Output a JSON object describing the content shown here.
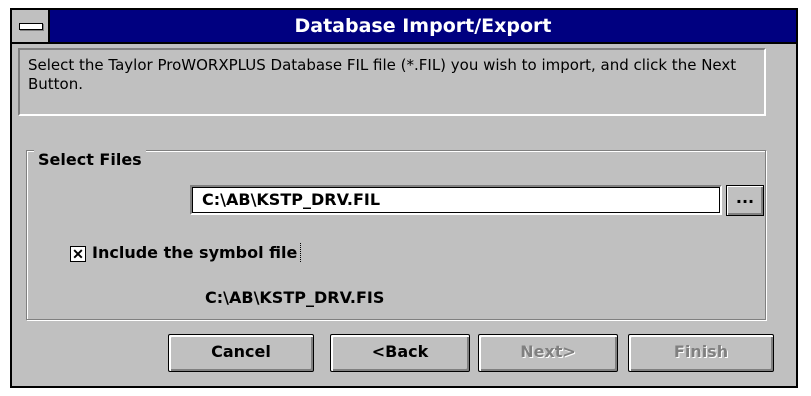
{
  "window": {
    "title": "Database Import/Export"
  },
  "info_text": "Select the Taylor ProWORXPLUS Database FIL file (*.FIL) you wish to import, and click the Next Button.",
  "select_files": {
    "group_label": "Select Files",
    "file_path": "C:\\AB\\KSTP_DRV.FIL",
    "browse_label": "...",
    "include_symbol_label": "Include the symbol file",
    "include_symbol_checked": true,
    "checkbox_mark": "✕",
    "symbol_path": "C:\\AB\\KSTP_DRV.FIS"
  },
  "buttons": {
    "cancel": "Cancel",
    "back": "<Back",
    "next": "Next>",
    "finish": "Finish"
  }
}
